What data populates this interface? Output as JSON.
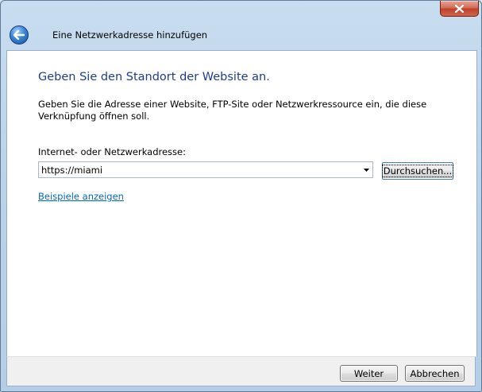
{
  "window": {
    "title": "Eine Netzwerkadresse hinzufügen"
  },
  "page": {
    "heading": "Geben Sie den Standort der Website an.",
    "description": "Geben Sie die Adresse einer Website, FTP-Site oder Netzwerkressource ein, die diese Verknüpfung öffnen soll.",
    "address_label": "Internet- oder Netzwerkadresse:",
    "address_value": "https://miami",
    "browse_label": "Durchsuchen...",
    "examples_link": "Beispiele anzeigen"
  },
  "footer": {
    "next_label": "Weiter",
    "cancel_label": "Abbrechen"
  },
  "icons": {
    "close": "close-icon",
    "back": "back-arrow-icon",
    "dropdown": "chevron-down-icon"
  },
  "colors": {
    "heading": "#1e3d8f",
    "link": "#0066cc",
    "close_button": "#c0422a",
    "back_button": "#3a84d8"
  }
}
